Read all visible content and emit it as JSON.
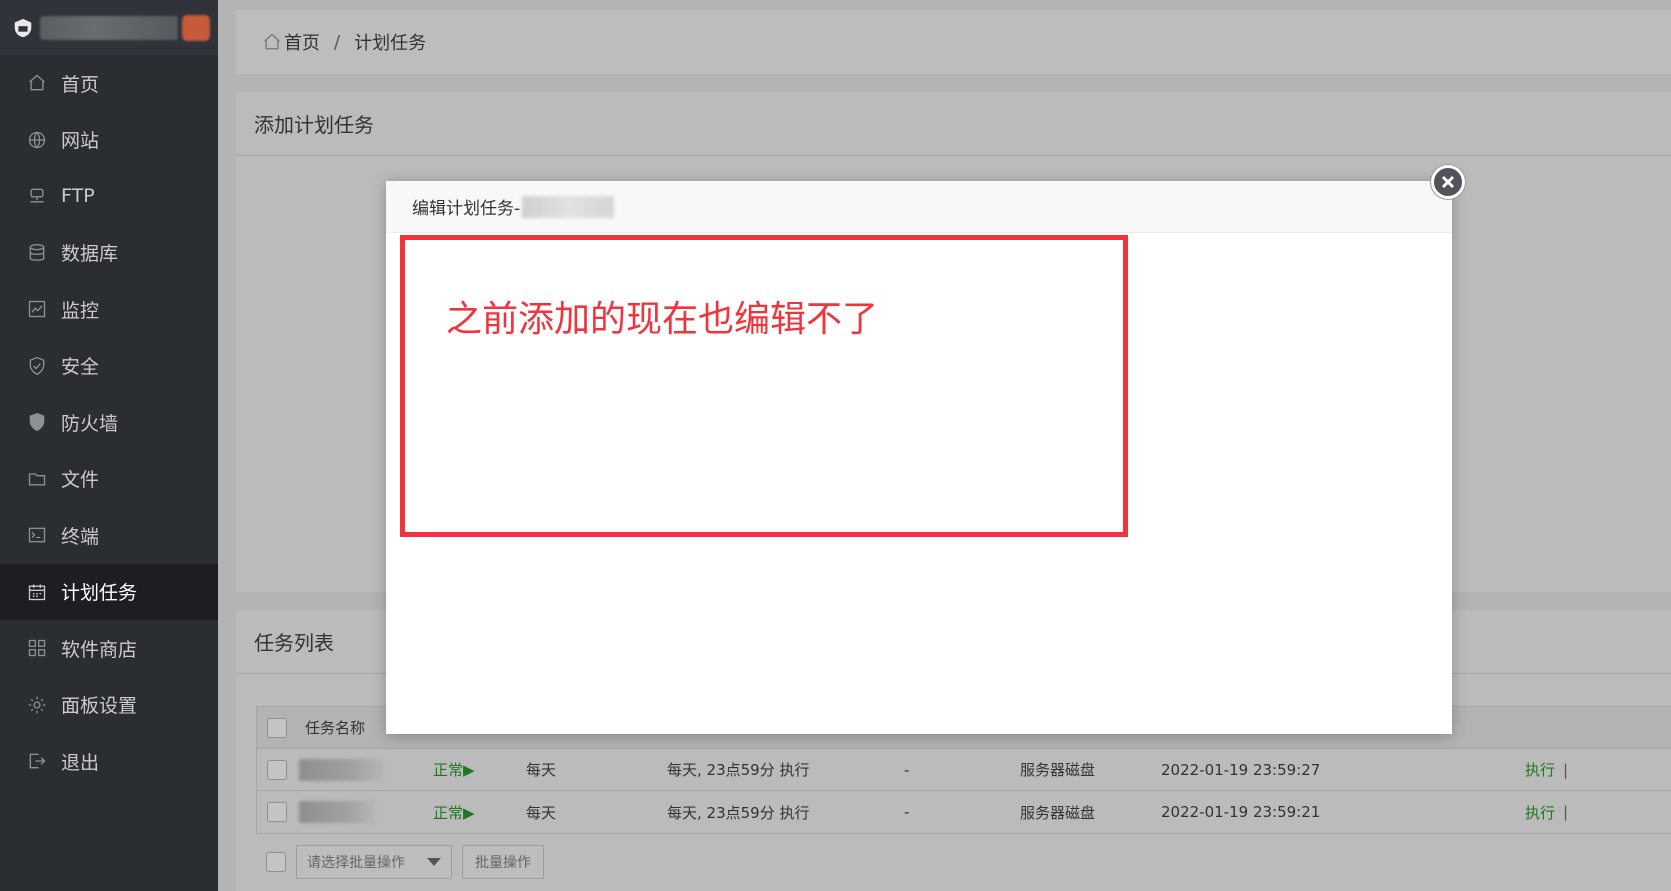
{
  "sidebar": {
    "items": [
      {
        "label": "首页",
        "icon": "home-icon"
      },
      {
        "label": "网站",
        "icon": "globe-icon"
      },
      {
        "label": "FTP",
        "icon": "ftp-server-icon"
      },
      {
        "label": "数据库",
        "icon": "database-icon"
      },
      {
        "label": "监控",
        "icon": "monitor-chart-icon"
      },
      {
        "label": "安全",
        "icon": "shield-check-icon"
      },
      {
        "label": "防火墙",
        "icon": "firewall-shield-icon"
      },
      {
        "label": "文件",
        "icon": "folder-icon"
      },
      {
        "label": "终端",
        "icon": "terminal-icon"
      },
      {
        "label": "计划任务",
        "icon": "calendar-icon"
      },
      {
        "label": "软件商店",
        "icon": "app-grid-icon"
      },
      {
        "label": "面板设置",
        "icon": "gear-icon"
      },
      {
        "label": "退出",
        "icon": "logout-icon"
      }
    ],
    "active_index": 9
  },
  "breadcrumb": {
    "home": "首页",
    "separator": "/",
    "current": "计划任务"
  },
  "add_panel": {
    "title": "添加计划任务"
  },
  "list_panel": {
    "title": "任务列表",
    "header_name": "任务名称",
    "rows": [
      {
        "status": "正常▶",
        "period": "每天",
        "cycle": "每天, 23点59分 执行",
        "backup_count": "-",
        "target": "服务器磁盘",
        "added": "2022-01-19 23:59:27",
        "action": "执行",
        "sep": "|"
      },
      {
        "status": "正常▶",
        "period": "每天",
        "cycle": "每天, 23点59分 执行",
        "backup_count": "-",
        "target": "服务器磁盘",
        "added": "2022-01-19 23:59:21",
        "action": "执行",
        "sep": "|"
      }
    ],
    "batch_select_placeholder": "请选择批量操作",
    "batch_button": "批量操作"
  },
  "modal": {
    "title": "编辑计划任务-"
  },
  "annotation": {
    "text": "之前添加的现在也编辑不了",
    "color": "#ef343d"
  }
}
